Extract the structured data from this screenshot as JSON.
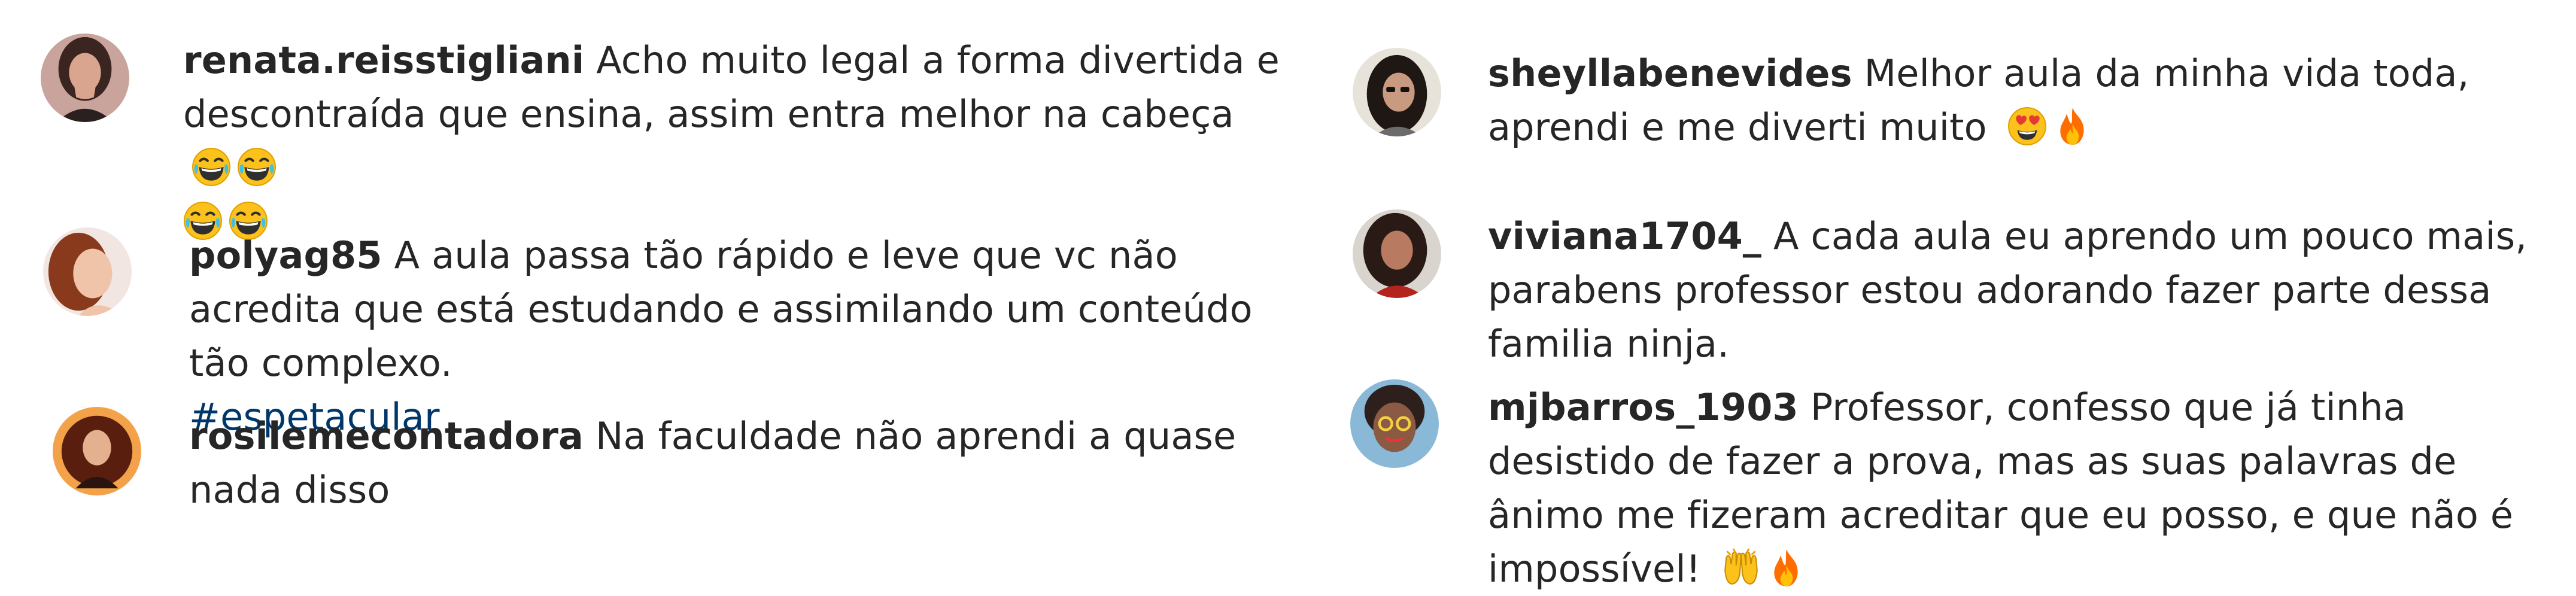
{
  "comments_left": [
    {
      "username": "renata.reisstigliani",
      "text": "Acho muito legal a forma divertida e descontraída que ensina, assim entra melhor na cabeça",
      "emojis": [
        "laughing-tears-emoji",
        "laughing-tears-emoji",
        "laughing-tears-emoji",
        "laughing-tears-emoji"
      ]
    },
    {
      "username": "polyag85",
      "text": "A aula passa tão rápido e leve que vc não acredita que está estudando e assimilando um conteúdo tão complexo.",
      "hashtag": "#espetacular"
    },
    {
      "username": "rosilemecontadora",
      "text": "Na faculdade não aprendi a quase nada disso"
    }
  ],
  "comments_right": [
    {
      "username": "sheyllabenevides",
      "text": "Melhor aula da minha vida toda, aprendi e me diverti muito",
      "emojis": [
        "heart-eyes-emoji",
        "fire-emoji"
      ]
    },
    {
      "username": "viviana1704_",
      "text": "A cada aula eu aprendo um pouco mais, parabens professor estou adorando fazer parte dessa familia ninja."
    },
    {
      "username": "mjbarros_1903",
      "text": "Professor, confesso que já tinha desistido de fazer a prova, mas as suas palavras de ânimo me fizeram acreditar que eu posso, e que não é impossível!",
      "emojis": [
        "raising-hands-emoji",
        "fire-emoji"
      ]
    }
  ]
}
